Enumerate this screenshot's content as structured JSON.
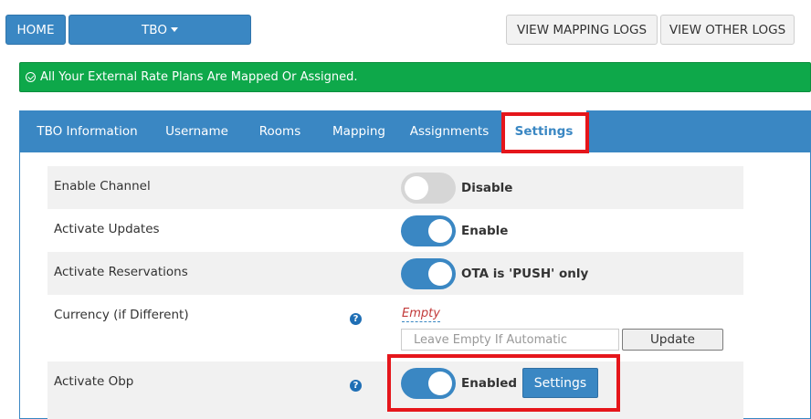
{
  "topbar": {
    "home_label": "HOME",
    "channel_label": "TBO",
    "view_mapping_logs": "VIEW MAPPING LOGS",
    "view_other_logs": "VIEW OTHER LOGS"
  },
  "alert": {
    "message": "All Your External Rate Plans Are Mapped Or Assigned.",
    "color": "#0ea84a"
  },
  "tabs": [
    {
      "label": "TBO Information",
      "active": false
    },
    {
      "label": "Username",
      "active": false
    },
    {
      "label": "Rooms",
      "active": false
    },
    {
      "label": "Mapping",
      "active": false
    },
    {
      "label": "Assignments",
      "active": false
    },
    {
      "label": "Settings",
      "active": true
    }
  ],
  "settings": {
    "enable_channel": {
      "label": "Enable Channel",
      "state": "off",
      "status": "Disable"
    },
    "activate_updates": {
      "label": "Activate Updates",
      "state": "on",
      "status": "Enable"
    },
    "activate_reservations": {
      "label": "Activate Reservations",
      "state": "on",
      "status": "OTA is 'PUSH' only"
    },
    "currency": {
      "label": "Currency (if Different)",
      "value": "Empty",
      "placeholder": "Leave Empty If Automatic",
      "update_label": "Update"
    },
    "activate_obp": {
      "label": "Activate Obp",
      "state": "on",
      "status": "Enabled",
      "settings_label": "Settings"
    }
  },
  "help_icon_glyph": "?",
  "colors": {
    "accent": "#3a87c3",
    "highlight": "#e5161b"
  }
}
